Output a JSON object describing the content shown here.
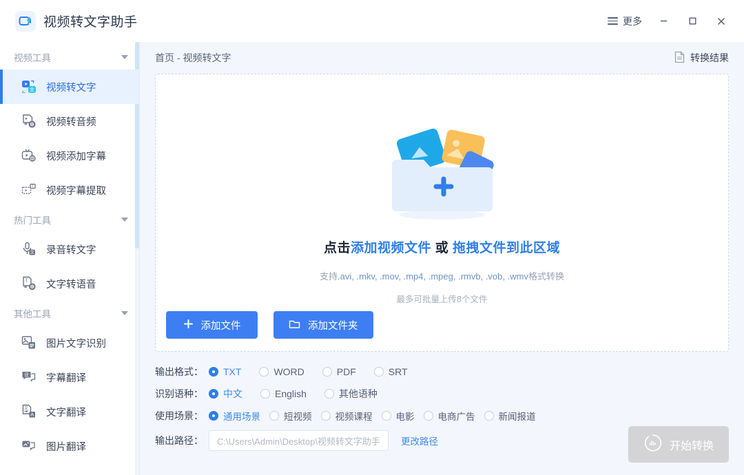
{
  "window": {
    "app_title": "视频转文字助手",
    "logo_icon": "video-convert-logo-icon",
    "more_label": "更多",
    "menu_icon": "hamburger-icon",
    "minimize_icon": "minimize-icon",
    "maximize_icon": "maximize-icon",
    "close_icon": "close-icon"
  },
  "sidebar": {
    "groups": [
      {
        "title": "视频工具",
        "items": [
          {
            "label": "视频转文字",
            "icon": "video-to-text-icon",
            "active": true
          },
          {
            "label": "视频转音频",
            "icon": "video-to-audio-icon",
            "active": false
          },
          {
            "label": "视频添加字幕",
            "icon": "video-add-subtitle-icon",
            "active": false
          },
          {
            "label": "视频字幕提取",
            "icon": "video-subtitle-extract-icon",
            "active": false
          }
        ]
      },
      {
        "title": "热门工具",
        "items": [
          {
            "label": "录音转文字",
            "icon": "audio-to-text-icon",
            "active": false
          },
          {
            "label": "文字转语音",
            "icon": "text-to-speech-icon",
            "active": false
          }
        ]
      },
      {
        "title": "其他工具",
        "items": [
          {
            "label": "图片文字识别",
            "icon": "image-ocr-icon",
            "active": false
          },
          {
            "label": "字幕翻译",
            "icon": "subtitle-translate-icon",
            "active": false
          },
          {
            "label": "文字翻译",
            "icon": "text-translate-icon",
            "active": false
          },
          {
            "label": "图片翻译",
            "icon": "image-translate-icon",
            "active": false
          }
        ]
      }
    ]
  },
  "main": {
    "breadcrumb": "首页 - 视频转文字",
    "result_link": "转换结果",
    "result_icon": "document-icon",
    "dropzone": {
      "illustration_icon": "folder-upload-illustration",
      "title_prefix": "点击",
      "title_accent1": "添加视频文件",
      "title_mid": " 或 ",
      "title_accent2": "拖拽文件到此区域",
      "formats_prefix": "支持",
      "formats": ".avi, .mkv, .mov, .mp4, .mpeg, .rmvb, .vob, .wmv",
      "formats_suffix": "格式转换",
      "limit": "最多可批量上传8个文件",
      "add_file_label": "添加文件",
      "add_file_icon": "plus-icon",
      "add_folder_label": "添加文件夹",
      "add_folder_icon": "folder-icon"
    },
    "options": {
      "format_label": "输出格式：",
      "formats": [
        {
          "label": "TXT",
          "selected": true
        },
        {
          "label": "WORD",
          "selected": false
        },
        {
          "label": "PDF",
          "selected": false
        },
        {
          "label": "SRT",
          "selected": false
        }
      ],
      "language_label": "识别语种：",
      "languages": [
        {
          "label": "中文",
          "selected": true
        },
        {
          "label": "English",
          "selected": false
        },
        {
          "label": "其他语种",
          "selected": false
        }
      ],
      "scene_label": "使用场景：",
      "scenes": [
        {
          "label": "通用场景",
          "selected": true
        },
        {
          "label": "短视频",
          "selected": false
        },
        {
          "label": "视频课程",
          "selected": false
        },
        {
          "label": "电影",
          "selected": false
        },
        {
          "label": "电商广告",
          "selected": false
        },
        {
          "label": "新闻报道",
          "selected": false
        }
      ],
      "path_label": "输出路径：",
      "path_placeholder": "C:\\Users\\Admin\\Desktop\\视频转文字助手",
      "path_value": "",
      "path_change_label": "更改路径"
    },
    "start_button": {
      "label": "开始转换",
      "icon": "waveform-circle-icon",
      "enabled": false
    }
  },
  "colors": {
    "accent": "#3d7ff3",
    "accent_text": "#2f7fe8",
    "page_bg": "#f4f6fd",
    "sidebar_active_bg": "#e8f1fe",
    "disabled_btn": "#d4d4d6"
  }
}
